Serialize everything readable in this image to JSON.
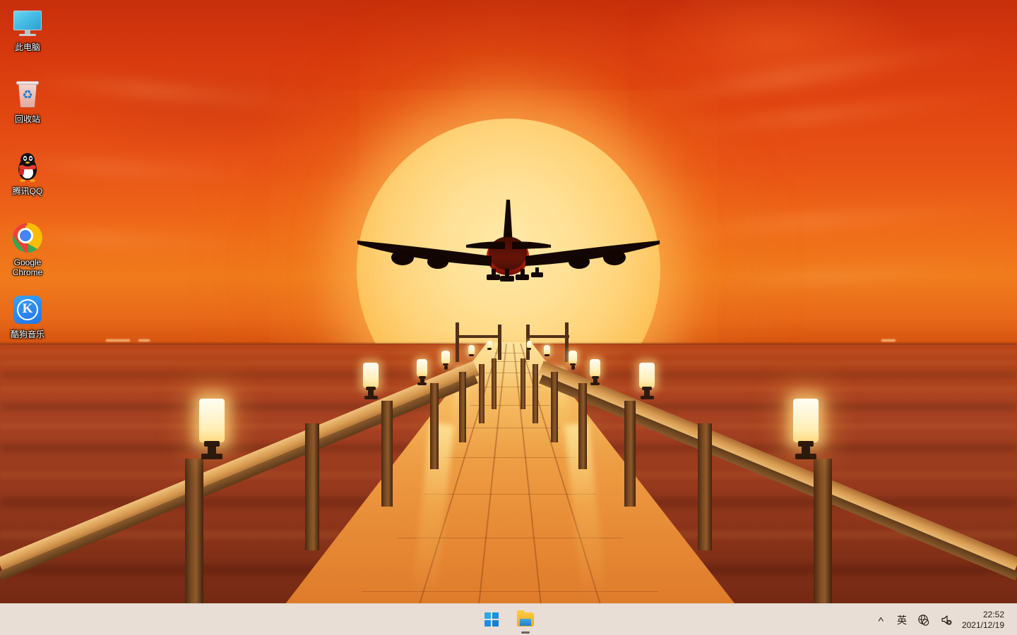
{
  "desktop": {
    "wallpaper_description": "Sunset over a wooden pier with an airplane silhouette in front of a large setting sun",
    "icons": [
      {
        "label": "此电脑",
        "icon": "monitor-icon",
        "name": "this-pc"
      },
      {
        "label": "回收站",
        "icon": "recycle-bin-icon",
        "name": "recycle-bin"
      },
      {
        "label": "腾讯QQ",
        "icon": "qq-penguin-icon",
        "name": "tencent-qq"
      },
      {
        "label": "Google Chrome",
        "icon": "chrome-icon",
        "name": "google-chrome"
      },
      {
        "label": "酷狗音乐",
        "icon": "kugou-icon",
        "name": "kugou-music"
      }
    ]
  },
  "taskbar": {
    "background_color": "#e9ded6",
    "start_button": {
      "label": "开始",
      "icon": "windows-logo-icon"
    },
    "pinned": [
      {
        "label": "文件资源管理器",
        "icon": "folder-icon",
        "running": true
      }
    ],
    "tray": {
      "show_hidden_icons": {
        "icon": "chevron-up-icon",
        "label": "˄"
      },
      "ime": {
        "label": "英",
        "icon": "ime-icon"
      },
      "network": {
        "icon": "globe-no-internet-icon",
        "label": "网络"
      },
      "volume": {
        "icon": "speaker-muted-icon",
        "label": "音量"
      },
      "clock": {
        "time": "22:52",
        "date": "2021/12/19"
      }
    }
  },
  "recycle_glyph": "♻"
}
